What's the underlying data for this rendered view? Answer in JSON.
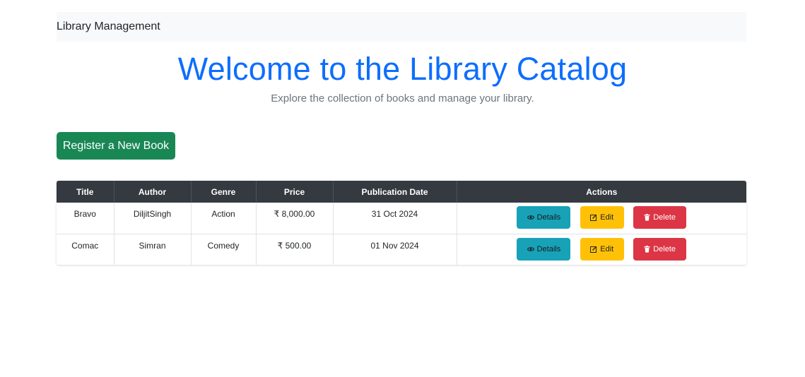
{
  "navbar": {
    "brand": "Library Management"
  },
  "hero": {
    "title": "Welcome to the Library Catalog",
    "subtitle": "Explore the collection of books and manage your library."
  },
  "register_button": "Register a New Book",
  "table": {
    "headers": [
      "Title",
      "Author",
      "Genre",
      "Price",
      "Publication Date",
      "Actions"
    ],
    "rows": [
      {
        "title": "Bravo",
        "author": "DiljitSingh",
        "genre": "Action",
        "price": "₹ 8,000.00",
        "date": "31 Oct 2024"
      },
      {
        "title": "Comac",
        "author": "Simran",
        "genre": "Comedy",
        "price": "₹ 500.00",
        "date": "01 Nov 2024"
      }
    ],
    "actions": {
      "details": "Details",
      "edit": "Edit",
      "delete": "Delete"
    }
  },
  "colors": {
    "primary": "#0d6efd",
    "success": "#198754",
    "info": "#17a2b8",
    "warning": "#ffc107",
    "danger": "#dc3545",
    "header_bg": "#343a40"
  },
  "icons": {
    "details": "eye-icon",
    "edit": "edit-icon",
    "delete": "trash-icon"
  }
}
